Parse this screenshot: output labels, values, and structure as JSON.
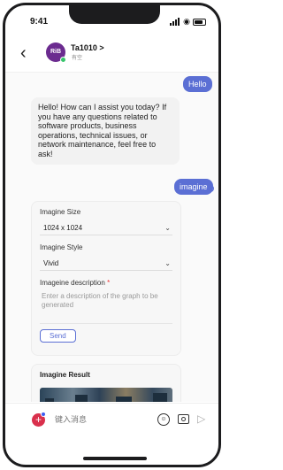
{
  "status_bar": {
    "time": "9:41"
  },
  "header": {
    "avatar_text": "RiB",
    "title": "Ta1010 >",
    "subtitle": "有空"
  },
  "messages": {
    "user_1": "Hello",
    "bot_1": "Hello! How can I assist you today? If you have any questions related to software products, business operations, technical issues, or network maintenance, feel free to ask!",
    "user_2": "imagine"
  },
  "imagine_form": {
    "size_label": "Imagine Size",
    "size_value": "1024 x 1024",
    "style_label": "Imagine Style",
    "style_value": "Vivid",
    "description_label": "Imageine description",
    "required_mark": "*",
    "description_placeholder": "Enter a description of the graph to be generated",
    "send_label": "Send"
  },
  "result": {
    "title": "Imagine Result"
  },
  "input_bar": {
    "placeholder": "键入消息"
  }
}
